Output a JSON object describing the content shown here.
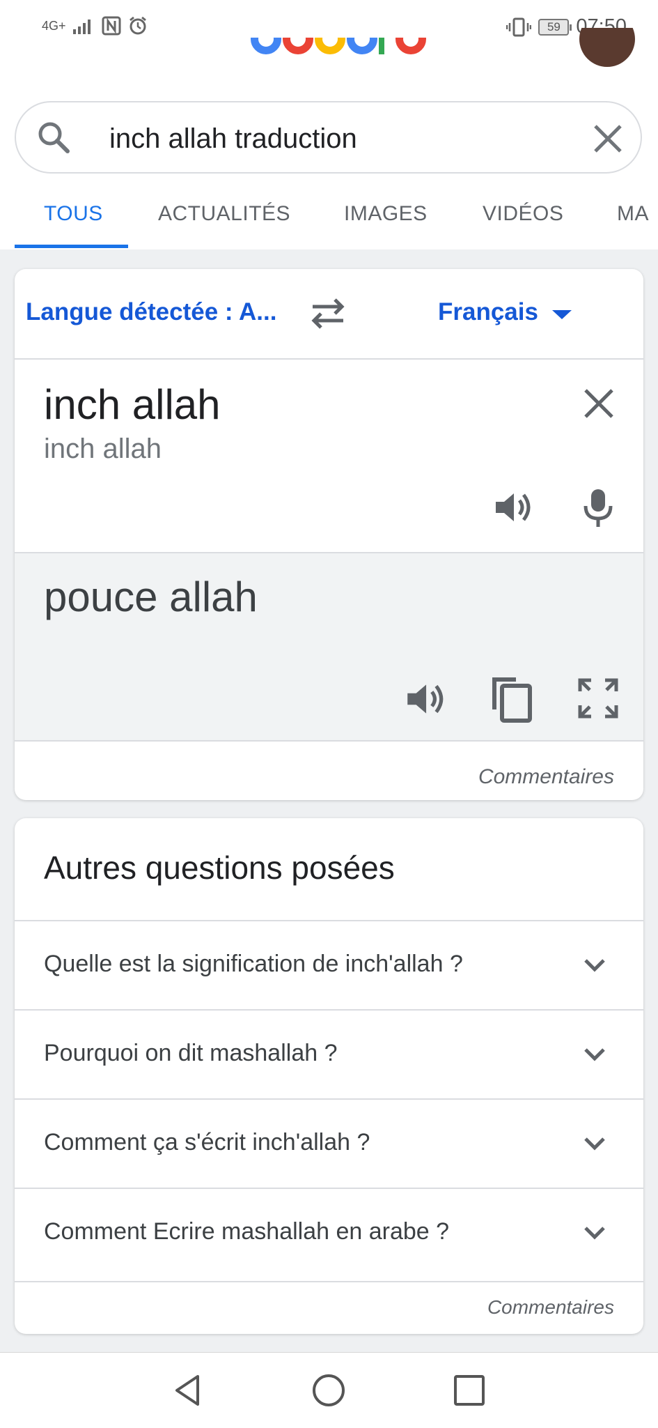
{
  "status_bar": {
    "network": "4G+",
    "battery": "59",
    "time": "07:50"
  },
  "search": {
    "query": "inch allah traduction"
  },
  "tabs": [
    {
      "label": "TOUS"
    },
    {
      "label": "ACTUALITÉS"
    },
    {
      "label": "IMAGES"
    },
    {
      "label": "VIDÉOS"
    },
    {
      "label": "MA"
    }
  ],
  "translator": {
    "source_lang": "Langue détectée : A...",
    "target_lang": "Français",
    "source_text": "inch allah",
    "source_translit": "inch allah",
    "translation": "pouce allah",
    "feedback": "Commentaires"
  },
  "people_also_ask": {
    "title": "Autres questions posées",
    "questions": [
      "Quelle est la signification de inch'allah ?",
      "Pourquoi on dit mashallah ?",
      "Comment ça s'écrit inch'allah ?",
      "Comment Ecrire mashallah en arabe ?"
    ],
    "feedback": "Commentaires"
  },
  "colors": {
    "accent": "#1a73e8",
    "link": "#1558d6",
    "background": "#eef0f2"
  }
}
